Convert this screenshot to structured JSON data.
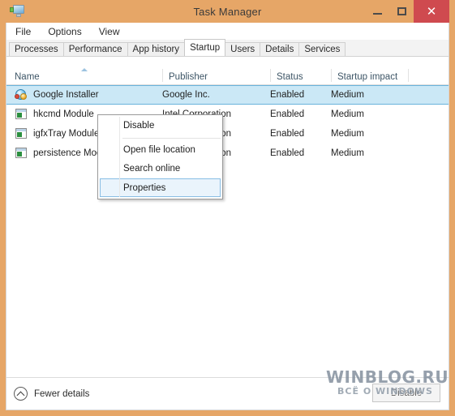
{
  "window": {
    "title": "Task Manager",
    "icon": "task-manager-icon",
    "frame_color": "#e6a667",
    "controls": {
      "minimize": "–",
      "maximize": "□",
      "close": "✕",
      "close_color": "#cf4a4f"
    }
  },
  "menubar": {
    "items": [
      {
        "label": "File"
      },
      {
        "label": "Options"
      },
      {
        "label": "View"
      }
    ]
  },
  "tabs": {
    "active": "Startup",
    "items": [
      {
        "label": "Processes",
        "active": false
      },
      {
        "label": "Performance",
        "active": false
      },
      {
        "label": "App history",
        "active": false
      },
      {
        "label": "Startup",
        "active": true
      },
      {
        "label": "Users",
        "active": false
      },
      {
        "label": "Details",
        "active": false
      },
      {
        "label": "Services",
        "active": false
      }
    ]
  },
  "table": {
    "sort_column": "Name",
    "sort_direction": "ascending",
    "columns": [
      {
        "label": "Name"
      },
      {
        "label": "Publisher"
      },
      {
        "label": "Status"
      },
      {
        "label": "Startup impact"
      }
    ],
    "rows": [
      {
        "name": "Google Installer",
        "publisher": "Google Inc.",
        "status": "Enabled",
        "impact": "Medium",
        "icon": "google-installer-icon",
        "selected": true
      },
      {
        "name": "hkcmd Module",
        "publisher": "Intel Corporation",
        "status": "Enabled",
        "impact": "Medium",
        "icon": "generic-app-icon",
        "selected": false
      },
      {
        "name": "igfxTray Module",
        "publisher": "Intel Corporation",
        "status": "Enabled",
        "impact": "Medium",
        "icon": "generic-app-icon",
        "selected": false
      },
      {
        "name": "persistence Module",
        "publisher": "Intel Corporation",
        "status": "Enabled",
        "impact": "Medium",
        "icon": "generic-app-icon",
        "selected": false
      }
    ]
  },
  "context_menu": {
    "highlighted": "Properties",
    "items": [
      {
        "label": "Disable",
        "highlighted": false
      },
      {
        "label": "Open file location",
        "highlighted": false
      },
      {
        "label": "Search online",
        "highlighted": false
      },
      {
        "label": "Properties",
        "highlighted": true
      }
    ]
  },
  "bottombar": {
    "fewer_details_label": "Fewer details",
    "fewer_details_icon": "chevron-up-circle-icon",
    "disable_label": "Disable"
  },
  "watermark": {
    "main": "WINBLOG.RU",
    "sub": "ВСЁ О WINDOWS"
  }
}
